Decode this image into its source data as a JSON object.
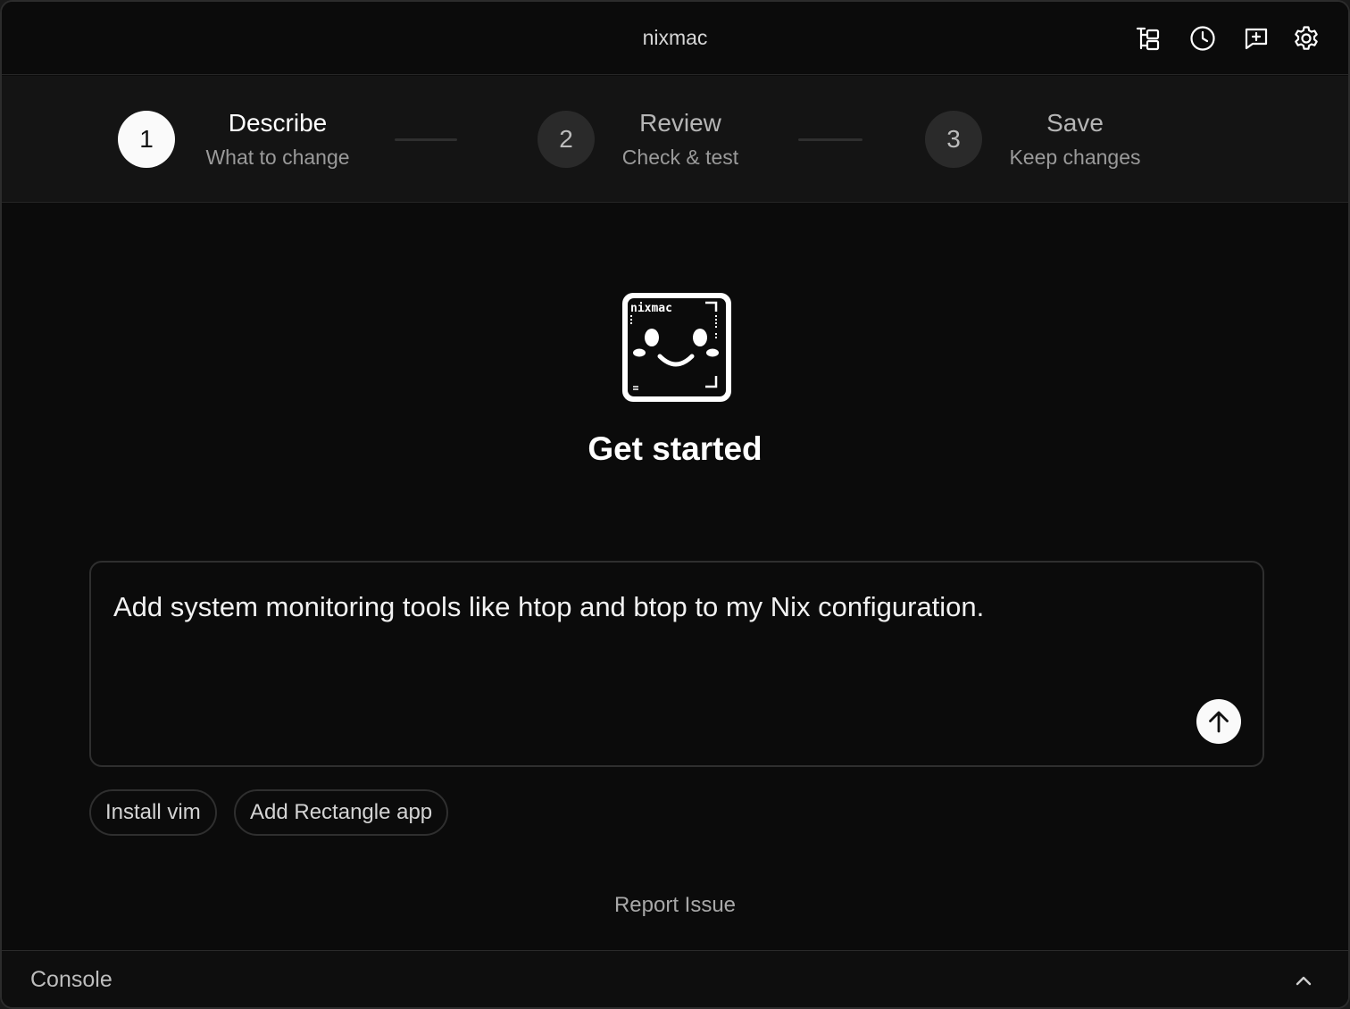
{
  "app": {
    "title": "nixmac"
  },
  "toolbar": {
    "icons": [
      "file-tree-icon",
      "history-clock-icon",
      "new-chat-icon",
      "settings-gear-icon"
    ]
  },
  "steps": [
    {
      "number": "1",
      "title": "Describe",
      "subtitle": "What to change",
      "state": "active"
    },
    {
      "number": "2",
      "title": "Review",
      "subtitle": "Check & test",
      "state": "inactive"
    },
    {
      "number": "3",
      "title": "Save",
      "subtitle": "Keep changes",
      "state": "inactive"
    }
  ],
  "hero": {
    "logo_text": "nixmac",
    "title": "Get started"
  },
  "prompt": {
    "value": "Add system monitoring tools like htop and btop to my Nix configuration.",
    "send_icon": "arrow-up-icon"
  },
  "suggestions": [
    "Install vim",
    "Add Rectangle app"
  ],
  "footer": {
    "report_label": "Report Issue"
  },
  "console": {
    "label": "Console",
    "toggle_icon": "chevron-up-icon"
  },
  "colors": {
    "background": "#0b0b0b",
    "stepper_bg": "#141414",
    "border": "#2f2f2f",
    "active_step": "#fafafa",
    "inactive_step": "#2a2a2a"
  }
}
